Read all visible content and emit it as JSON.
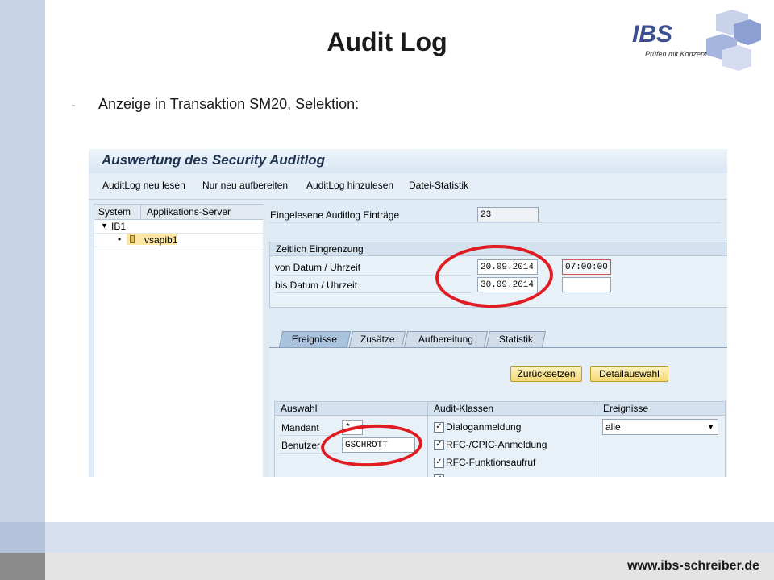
{
  "slide": {
    "title": "Audit Log",
    "bullet_dash": "-",
    "bullet_text": "Anzeige in Transaktion SM20, Selektion:",
    "footer_url": "www.ibs-schreiber.de",
    "logo": {
      "brand": "IBS",
      "tagline": "Prüfen mit Konzept"
    }
  },
  "sap": {
    "window_title": "Auswertung des Security Auditlog",
    "toolbar": [
      "AuditLog neu lesen",
      "Nur neu aufbereiten",
      "AuditLog hinzulesen",
      "Datei-Statistik"
    ],
    "tree": {
      "col_system": "System",
      "col_server": "Applikations-Server",
      "system_name": "IB1",
      "server_name": "vsapib1"
    },
    "entries": {
      "label": "Eingelesene Auditlog Einträge",
      "value": "23"
    },
    "time_group": {
      "title": "Zeitlich Eingrenzung",
      "from_label": "von Datum / Uhrzeit",
      "from_date": "20.09.2014",
      "from_time": "07:00:00",
      "to_label": "bis Datum / Uhrzeit",
      "to_date": "30.09.2014",
      "to_time": ""
    },
    "tabs": [
      "Ereignisse",
      "Zusätze",
      "Aufbereitung",
      "Statistik"
    ],
    "active_tab": 0,
    "buttons": {
      "reset": "Zurücksetzen",
      "detail": "Detailauswahl"
    },
    "selection": {
      "title": "Auswahl",
      "mandant_label": "Mandant",
      "mandant_value": "*",
      "user_label": "Benutzer",
      "user_value": "GSCHROTT"
    },
    "audit_classes": {
      "title": "Audit-Klassen",
      "items": [
        "Dialoganmeldung",
        "RFC-/CPIC-Anmeldung",
        "RFC-Funktionsaufruf"
      ],
      "checked": [
        true,
        true,
        true,
        true
      ]
    },
    "events": {
      "title": "Ereignisse",
      "selected": "alle"
    }
  },
  "colors": {
    "highlight_ellipse": "#e01b22",
    "sap_title": "#1f3350",
    "slide_sidebar": "#c7d4e8"
  },
  "icons": [
    "triangle-down-icon",
    "bullet-icon",
    "server-icon",
    "checkbox-icon",
    "dropdown-arrow-icon"
  ]
}
